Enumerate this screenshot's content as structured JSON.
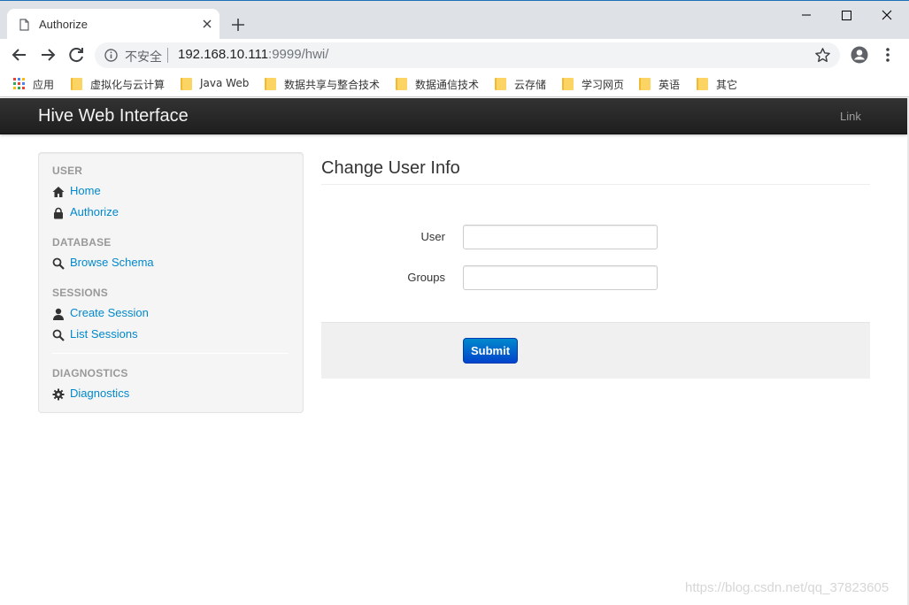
{
  "browser": {
    "tab_title": "Authorize",
    "security_text": "不安全",
    "url_host": "192.168.10.111",
    "url_rest": ":9999/hwi/",
    "bookmarks": [
      "应用",
      "虚拟化与云计算",
      "Java Web",
      "数据共享与整合技术",
      "数据通信技术",
      "云存储",
      "学习网页",
      "英语",
      "其它"
    ]
  },
  "navbar": {
    "brand": "Hive Web Interface",
    "link": "Link"
  },
  "sidebar": {
    "sections": [
      {
        "header": "USER",
        "items": [
          {
            "label": "Home",
            "icon": "home-icon"
          },
          {
            "label": "Authorize",
            "icon": "lock-icon"
          }
        ]
      },
      {
        "header": "DATABASE",
        "items": [
          {
            "label": "Browse Schema",
            "icon": "search-icon"
          }
        ]
      },
      {
        "header": "SESSIONS",
        "items": [
          {
            "label": "Create Session",
            "icon": "user-icon"
          },
          {
            "label": "List Sessions",
            "icon": "search-icon"
          }
        ]
      },
      {
        "header": "DIAGNOSTICS",
        "items": [
          {
            "label": "Diagnostics",
            "icon": "cog-icon"
          }
        ]
      }
    ]
  },
  "form": {
    "title": "Change User Info",
    "user_label": "User",
    "user_value": "",
    "groups_label": "Groups",
    "groups_value": "",
    "submit_label": "Submit"
  },
  "watermark": "https://blog.csdn.net/qq_37823605",
  "colors": {
    "link": "#0088cc",
    "navbar": "#222222",
    "button": "#0055cc"
  }
}
